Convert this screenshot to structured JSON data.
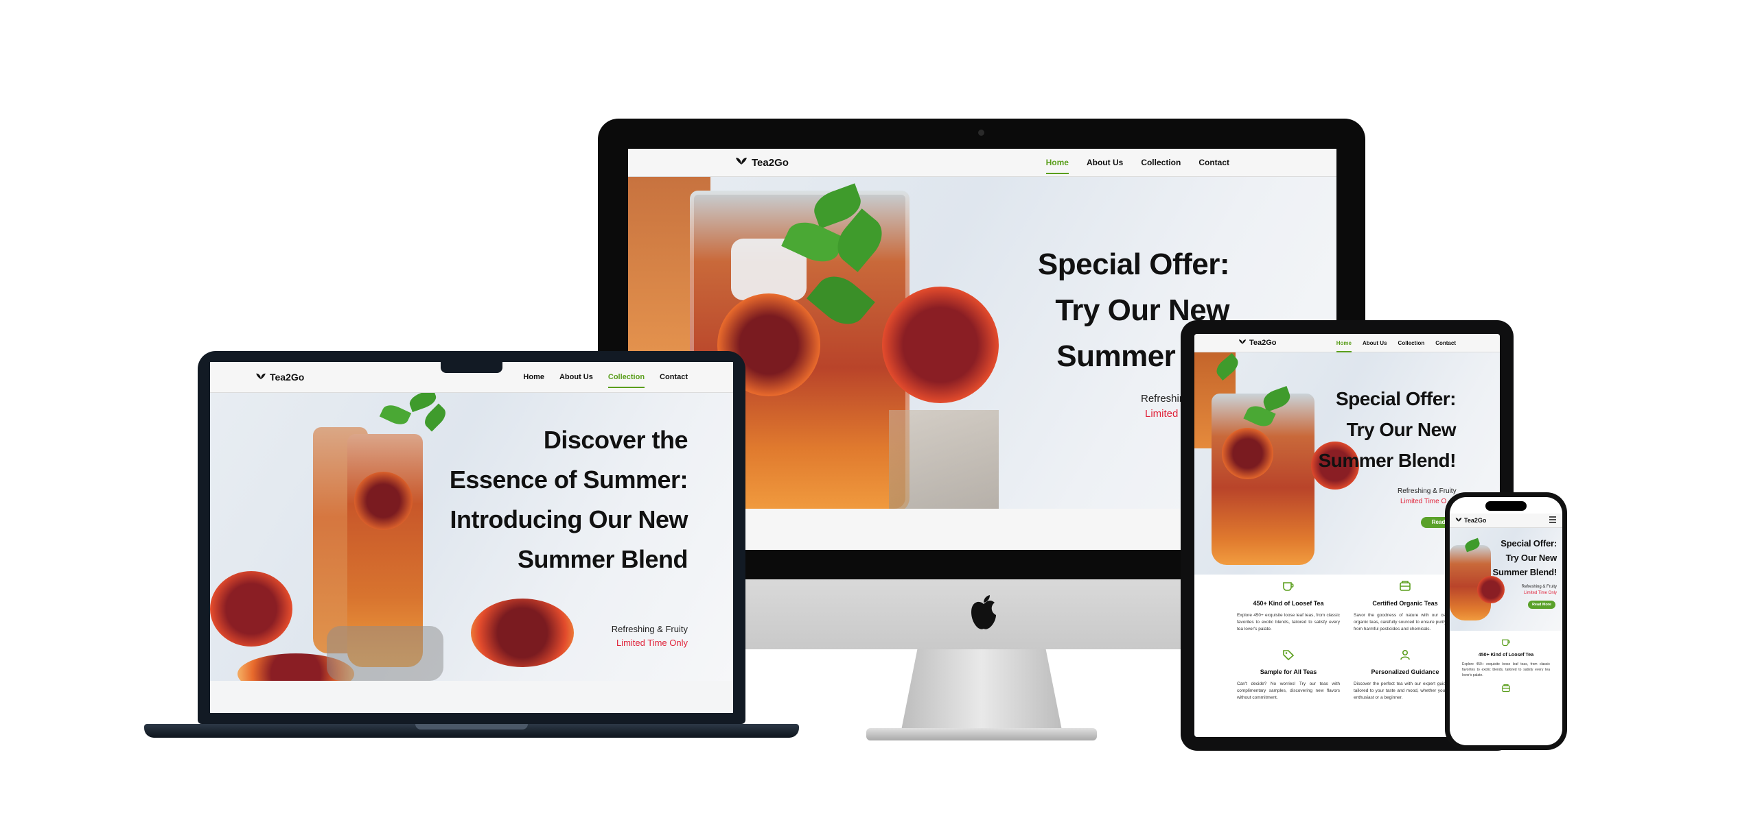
{
  "brand": {
    "name": "Tea2Go",
    "leaf_icon": "leaf-icon"
  },
  "desktop": {
    "nav": [
      {
        "label": "Home",
        "active": true
      },
      {
        "label": "About Us",
        "active": false
      },
      {
        "label": "Collection",
        "active": false
      },
      {
        "label": "Contact",
        "active": false
      }
    ],
    "hero": {
      "line1": "Special Offer:",
      "line2": "Try Our New",
      "line3": "Summer Ble",
      "sub1": "Refreshin",
      "sub2": "Limited"
    }
  },
  "laptop": {
    "nav": [
      {
        "label": "Home",
        "active": false
      },
      {
        "label": "About Us",
        "active": false
      },
      {
        "label": "Collection",
        "active": true
      },
      {
        "label": "Contact",
        "active": false
      }
    ],
    "hero": {
      "line1": "Discover the",
      "line2": "Essence of Summer:",
      "line3": "Introducing Our New",
      "line4": "Summer Blend",
      "sub1": "Refreshing & Fruity",
      "sub2": "Limited Time Only"
    }
  },
  "tablet": {
    "nav": [
      {
        "label": "Home",
        "active": true
      },
      {
        "label": "About Us",
        "active": false
      },
      {
        "label": "Collection",
        "active": false
      },
      {
        "label": "Contact",
        "active": false
      }
    ],
    "hero": {
      "line1": "Special Offer:",
      "line2": "Try Our New",
      "line3": "Summer Blend!",
      "sub1": "Refreshing & Fruity",
      "sub2": "Limited Time O",
      "button": "Read M"
    },
    "features": [
      {
        "icon": "cup-icon",
        "title": "450+ Kind of Loosef Tea",
        "text": "Explore 450+ exquisite loose leaf teas, from classic favorites to exotic blends, tailored to satisfy every tea lover's palate."
      },
      {
        "icon": "badge-icon",
        "title": "Certified Organic Teas",
        "text": "Savor the goodness of nature with our certified organic teas, carefully sourced to ensure purity, free from harmful pesticides and chemicals."
      },
      {
        "icon": "tag-icon",
        "title": "Sample for All Teas",
        "text": "Can't decide? No worries! Try our teas with complimentary samples, discovering new flavors without commitment."
      },
      {
        "icon": "person-icon",
        "title": "Personalized Guidance",
        "text": "Discover the perfect tea with our expert guidance, tailored to your taste and mood, whether you're an enthusiast or a beginner."
      }
    ]
  },
  "phone": {
    "hero": {
      "line1": "Special Offer:",
      "line2": "Try Our New",
      "line3": "Summer Blend!",
      "sub1": "Refreshing & Fruity",
      "sub2": "Limited Time Only",
      "button": "Read More"
    },
    "feature": {
      "icon": "cup-icon",
      "title": "450+ Kind of Loosef Tea",
      "text": "Explore 450+ exquisite loose leaf teas, from classic favorites to exotic blends, tailored to satisfy every tea lover's palate."
    },
    "menu_icon": "hamburger-icon"
  },
  "colors": {
    "accent": "#5a9e1c",
    "limited": "#e0233a",
    "button": "#5aa12a"
  }
}
